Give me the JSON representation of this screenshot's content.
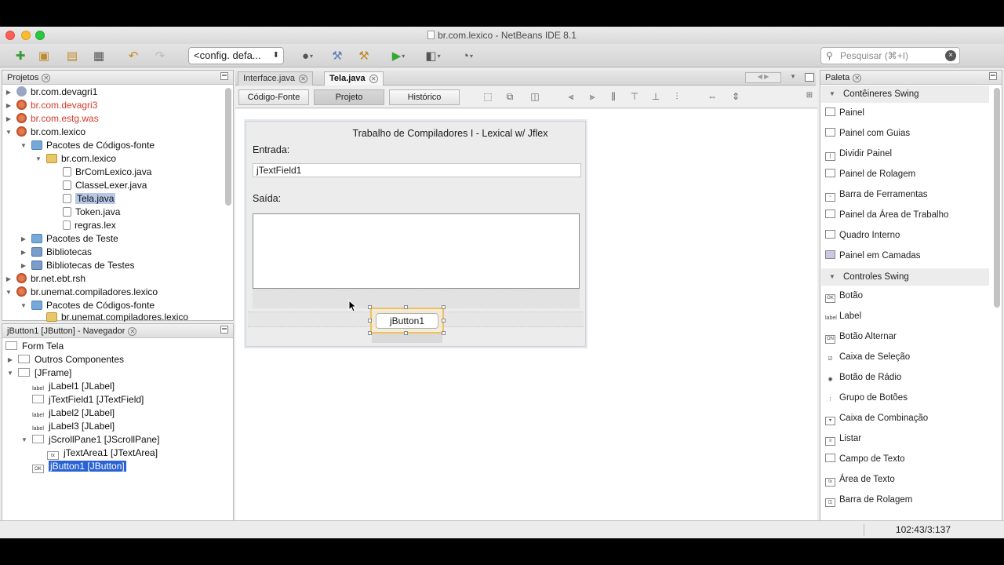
{
  "window": {
    "title": "br.com.lexico - NetBeans IDE 8.1"
  },
  "toolbar": {
    "config_value": "<config. defa...",
    "search_placeholder": "Pesquisar (⌘+I)"
  },
  "projects_panel": {
    "title": "Projetos",
    "items": [
      {
        "label": "br.com.devagri1",
        "color": "normal"
      },
      {
        "label": "br.com.devagri3",
        "color": "red"
      },
      {
        "label": "br.com.estg.was",
        "color": "red"
      },
      {
        "label": "br.com.lexico",
        "color": "normal"
      },
      {
        "label": "Pacotes de Códigos-fonte"
      },
      {
        "label": "br.com.lexico"
      },
      {
        "label": "BrComLexico.java"
      },
      {
        "label": "ClasseLexer.java"
      },
      {
        "label": "Tela.java"
      },
      {
        "label": "Token.java"
      },
      {
        "label": "regras.lex"
      },
      {
        "label": "Pacotes de Teste"
      },
      {
        "label": "Bibliotecas"
      },
      {
        "label": "Bibliotecas de Testes"
      },
      {
        "label": "br.net.ebt.rsh"
      },
      {
        "label": "br.unemat.compiladores.lexico"
      },
      {
        "label": "Pacotes de Códigos-fonte"
      },
      {
        "label": "br.unemat.compiladores.lexico"
      }
    ]
  },
  "navigator_panel": {
    "title": "jButton1 [JButton] - Navegador",
    "items": [
      {
        "label": "Form Tela"
      },
      {
        "label": "Outros Componentes"
      },
      {
        "label": "[JFrame]"
      },
      {
        "label": "jLabel1 [JLabel]"
      },
      {
        "label": "jTextField1 [JTextField]"
      },
      {
        "label": "jLabel2 [JLabel]"
      },
      {
        "label": "jLabel3 [JLabel]"
      },
      {
        "label": "jScrollPane1 [JScrollPane]"
      },
      {
        "label": "jTextArea1 [JTextArea]"
      },
      {
        "label": "jButton1 [JButton]"
      }
    ]
  },
  "editor": {
    "tabs": [
      {
        "label": "Interface.java"
      },
      {
        "label": "Tela.java"
      }
    ],
    "view_buttons": {
      "source": "Código-Fonte",
      "design": "Projeto",
      "history": "Histórico"
    },
    "form": {
      "title": "Trabalho de Compiladores I - Lexical w/ Jflex",
      "entrada_label": "Entrada:",
      "textfield_value": "jTextField1",
      "saida_label": "Saída:",
      "button_label": "jButton1"
    }
  },
  "palette": {
    "title": "Paleta",
    "categories": [
      {
        "label": "Contêineres Swing",
        "items": [
          "Painel",
          "Painel com Guias",
          "Dividir Painel",
          "Painel de Rolagem",
          "Barra de Ferramentas",
          "Painel da Área de Trabalho",
          "Quadro Interno",
          "Painel em Camadas"
        ]
      },
      {
        "label": "Controles Swing",
        "items": [
          "Botão",
          "Label",
          "Botão Alternar",
          "Caixa de Seleção",
          "Botão de Rádio",
          "Grupo de Botões",
          "Caixa de Combinação",
          "Listar",
          "Campo de Texto",
          "Área de Texto",
          "Barra de Rolagem"
        ]
      }
    ]
  },
  "status": {
    "position": "102:43/3:137"
  }
}
